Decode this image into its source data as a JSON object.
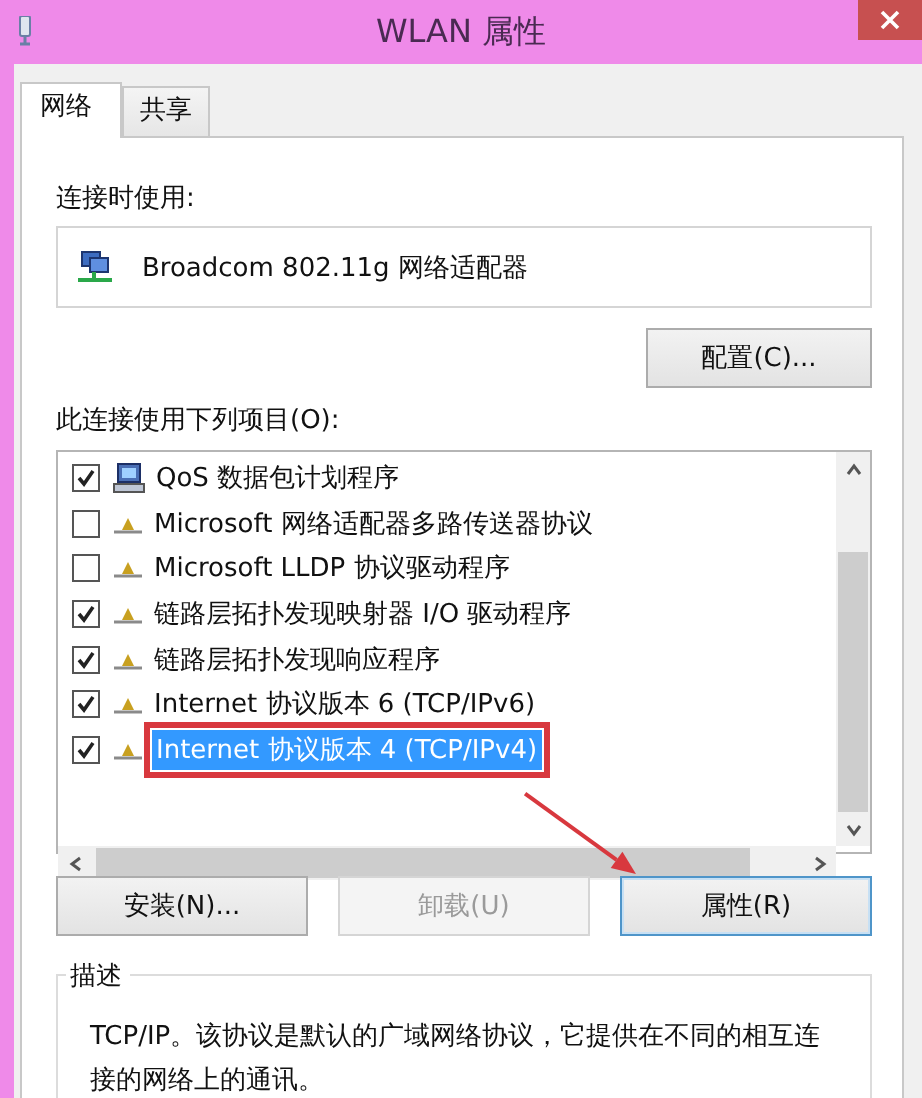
{
  "window": {
    "title": "WLAN 属性"
  },
  "tabs": [
    {
      "label": "网络",
      "selected": true
    },
    {
      "label": "共享",
      "selected": false
    }
  ],
  "connect_using": {
    "label": "连接时使用:",
    "adapter": "Broadcom 802.11g 网络适配器",
    "configure_button": "配置(C)..."
  },
  "items_label": "此连接使用下列项目(O):",
  "items": [
    {
      "kind": "service",
      "label": "QoS 数据包计划程序",
      "checked": true,
      "selected": false,
      "annotated": false
    },
    {
      "kind": "protocol",
      "label": "Microsoft 网络适配器多路传送器协议",
      "checked": false,
      "selected": false,
      "annotated": false
    },
    {
      "kind": "protocol",
      "label": "Microsoft LLDP 协议驱动程序",
      "checked": false,
      "selected": false,
      "annotated": false
    },
    {
      "kind": "protocol",
      "label": "链路层拓扑发现映射器 I/O 驱动程序",
      "checked": true,
      "selected": false,
      "annotated": false
    },
    {
      "kind": "protocol",
      "label": "链路层拓扑发现响应程序",
      "checked": true,
      "selected": false,
      "annotated": false
    },
    {
      "kind": "protocol",
      "label": "Internet 协议版本 6 (TCP/IPv6)",
      "checked": true,
      "selected": false,
      "annotated": false
    },
    {
      "kind": "protocol",
      "label": "Internet 协议版本 4 (TCP/IPv4)",
      "checked": true,
      "selected": true,
      "annotated": true
    }
  ],
  "buttons": [
    {
      "label": "安装(N)...",
      "disabled": false,
      "focused": false,
      "annotated": false
    },
    {
      "label": "卸载(U)",
      "disabled": true,
      "focused": false,
      "annotated": false
    },
    {
      "label": "属性(R)",
      "disabled": false,
      "focused": true,
      "annotated": true
    }
  ],
  "description": {
    "title": "描述",
    "text": "TCP/IP。该协议是默认的广域网络协议，它提供在不同的相互连接的网络上的通讯。"
  }
}
